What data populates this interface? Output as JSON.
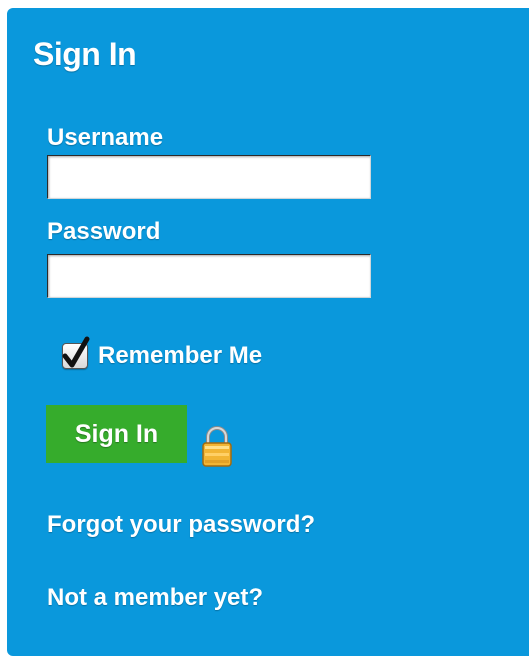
{
  "signin_panel": {
    "title": "Sign In",
    "username": {
      "label": "Username",
      "value": "",
      "placeholder": ""
    },
    "password": {
      "label": "Password",
      "value": "",
      "placeholder": ""
    },
    "remember_me": {
      "label": "Remember Me",
      "checked": true
    },
    "submit_label": "Sign In",
    "forgot_password_link": "Forgot your password?",
    "not_member_link": "Not a member yet?"
  },
  "icons": {
    "checkmark": "checkmark-icon",
    "lock": "padlock-icon"
  },
  "colors": {
    "panel_background": "#0a98dc",
    "button_background": "#36ac2c",
    "text": "#ffffff",
    "lock_body": "#f2b534"
  }
}
